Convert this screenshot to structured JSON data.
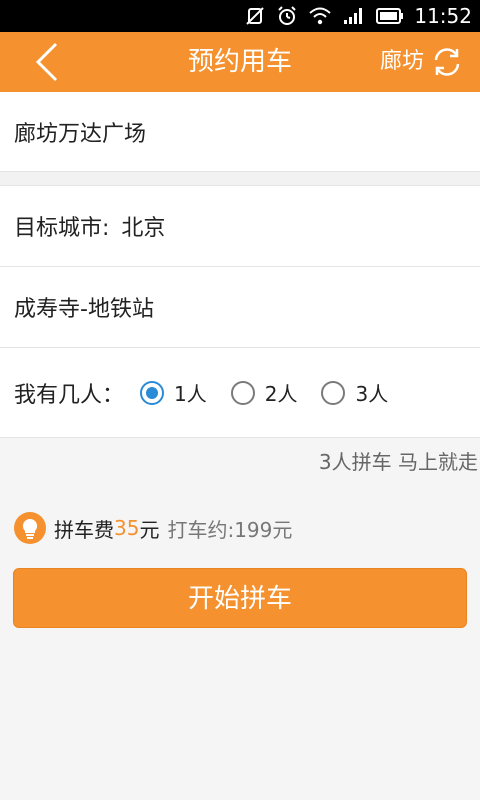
{
  "status_bar": {
    "time": "11:52",
    "icons": [
      "mute-vibrate-icon",
      "alarm-icon",
      "wifi-icon",
      "signal-icon",
      "battery-icon"
    ]
  },
  "header": {
    "title": "预约用车",
    "city": "廊坊",
    "back_icon": "chevron-left-icon",
    "refresh_icon": "refresh-icon"
  },
  "form": {
    "start_location": "廊坊万达广场",
    "target_city_label": "目标城市:",
    "target_city": "北京",
    "destination": "成寿寺-地铁站",
    "people_label": "我有几人：",
    "people_options": [
      "1人",
      "2人",
      "3人"
    ],
    "people_selected": 0
  },
  "hint": "3人拼车 马上就走",
  "fee": {
    "label": "拼车费",
    "price": "35",
    "unit": "元",
    "taxi_estimate": "打车约:199元"
  },
  "action_button": "开始拼车",
  "colors": {
    "accent": "#f5912e",
    "radio_checked": "#2a8bd6"
  }
}
